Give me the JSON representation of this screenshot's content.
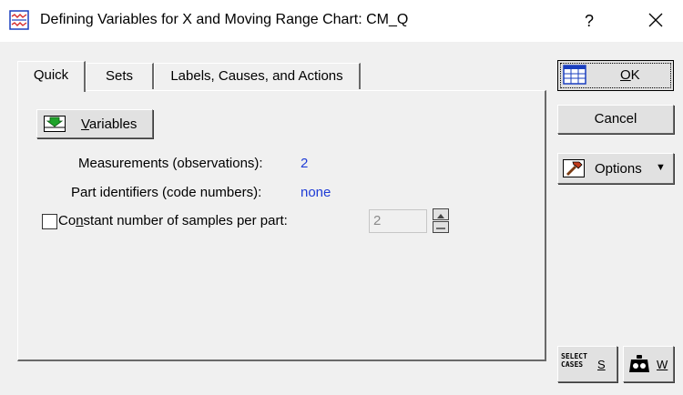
{
  "window": {
    "title": "Defining Variables for X and Moving Range Chart: CM_Q",
    "help_label": "?"
  },
  "tabs": [
    {
      "label": "Quick"
    },
    {
      "label": "Sets"
    },
    {
      "label": "Labels, Causes, and Actions"
    }
  ],
  "quick": {
    "variables_button": {
      "mnemonic": "V",
      "rest": "ariables"
    },
    "measurements": {
      "label": "Measurements (observations):",
      "value": "2"
    },
    "part_identifiers": {
      "label": "Part identifiers (code numbers):",
      "value": "none"
    },
    "constant_samples": {
      "pre": "Co",
      "mnemonic": "n",
      "post": "stant number of samples per part:",
      "checked": false,
      "value": "2"
    }
  },
  "buttons": {
    "ok": {
      "mnemonic": "O",
      "rest": "K"
    },
    "cancel": "Cancel",
    "options": "Options",
    "select_cases": {
      "icon_line1": "SELECT",
      "icon_line2": "CASES",
      "label": "S"
    },
    "weights": {
      "label": "W"
    }
  },
  "colors": {
    "link_value": "#1f3cd6",
    "background": "#f0f0f0"
  },
  "icons": {
    "app": "chart-window-icon",
    "close": "close-icon",
    "variables": "variables-down-arrow-icon",
    "ok": "ok-grid-icon",
    "options": "options-hammer-icon",
    "weights": "weight-icon",
    "options_arrow": "dropdown-arrow-icon"
  }
}
